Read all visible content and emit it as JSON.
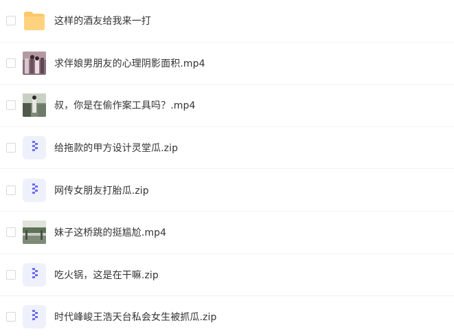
{
  "files": [
    {
      "name": "这样的酒友给我来一打",
      "type": "folder",
      "icon": "folder-icon"
    },
    {
      "name": "求伴娘男朋友的心理阴影面积.mp4",
      "type": "video",
      "icon": "video-thumbnail"
    },
    {
      "name": "叔，你是在偷作案工具吗？.mp4",
      "type": "video",
      "icon": "video-thumbnail"
    },
    {
      "name": "给拖款的甲方设计灵堂瓜.zip",
      "type": "zip",
      "icon": "zip-icon"
    },
    {
      "name": "网传女朋友打胎瓜.zip",
      "type": "zip",
      "icon": "zip-icon"
    },
    {
      "name": "妹子这桥跳的挺尴尬.mp4",
      "type": "video",
      "icon": "video-thumbnail"
    },
    {
      "name": "吃火锅，这是在干嘛.zip",
      "type": "zip",
      "icon": "zip-icon"
    },
    {
      "name": "时代峰峻王浩天台私会女生被抓瓜.zip",
      "type": "zip",
      "icon": "zip-icon"
    }
  ],
  "colors": {
    "folder": "#ffca6a",
    "zip_bg": "#eef0fb",
    "zip_accent": "#6f6cf2",
    "row_border": "#f1f2f4",
    "text": "#333333"
  }
}
